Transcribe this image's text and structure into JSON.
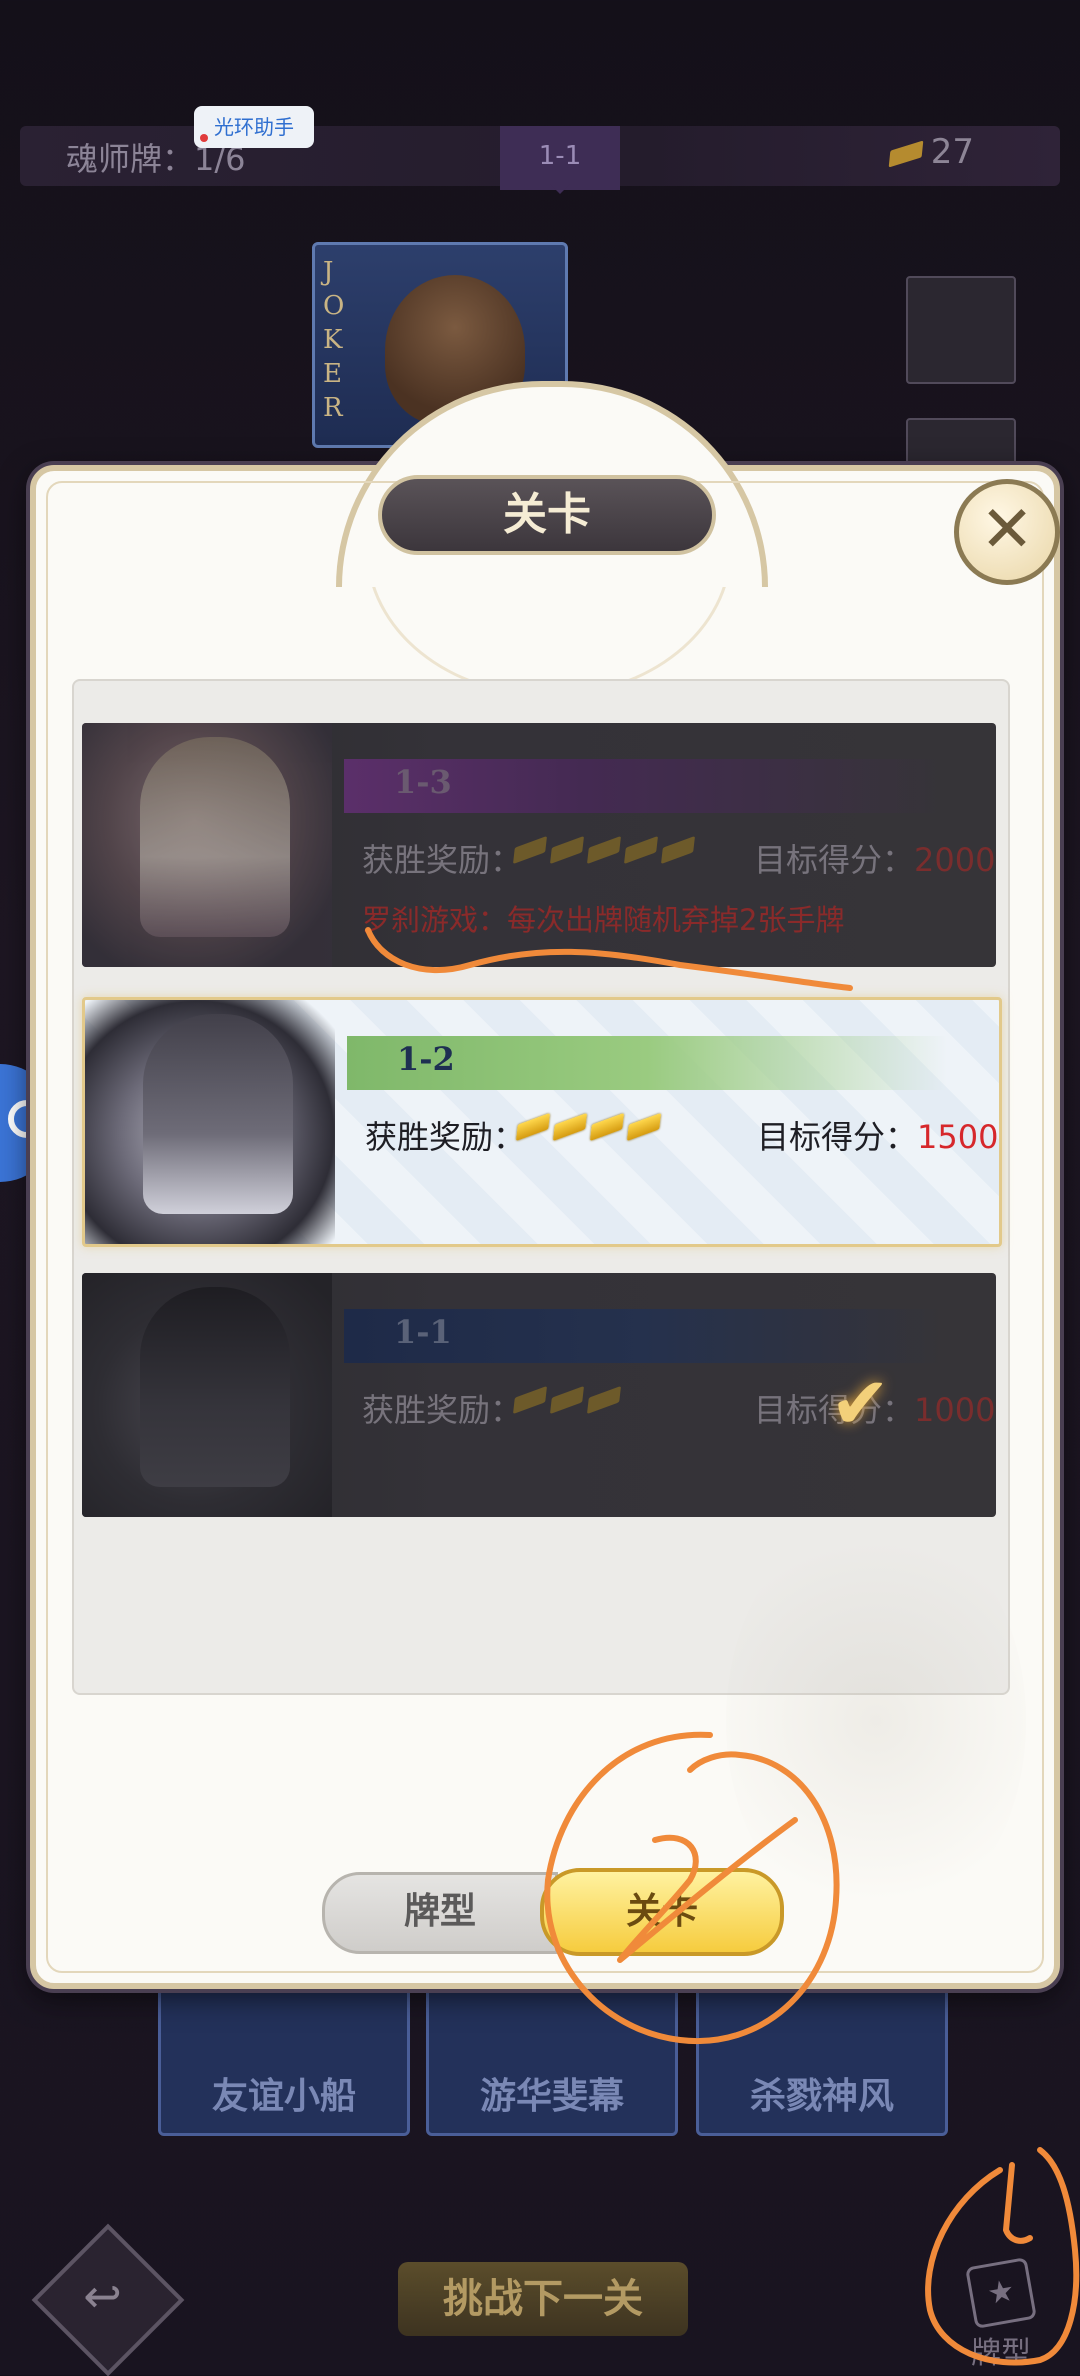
{
  "topbar": {
    "hunter_label": "魂师牌：1/6",
    "current_level": "1-1",
    "gold": "27"
  },
  "assist_badge": "光环助手",
  "joker_letters": "JOKER",
  "bottom_cards": [
    "友谊小船",
    "游华斐幕",
    "杀戮神风"
  ],
  "back_icon": "↩",
  "next_button": "挑战下一关",
  "deck_corner_label": "牌型",
  "modal": {
    "title": "关卡",
    "close": "✕",
    "levels": [
      {
        "id": "1-3",
        "reward_label": "获胜奖励：",
        "reward_gold_bars": 5,
        "target_label": "目标得分：",
        "target_value": "2000",
        "rule": "罗刹游戏：每次出牌随机弃掉2张手牌",
        "state": "locked"
      },
      {
        "id": "1-2",
        "reward_label": "获胜奖励：",
        "reward_gold_bars": 4,
        "target_label": "目标得分：",
        "target_value": "1500",
        "state": "current"
      },
      {
        "id": "1-1",
        "reward_label": "获胜奖励：",
        "reward_gold_bars": 3,
        "target_label": "目标得分：",
        "target_value": "1000",
        "state": "completed",
        "check": "✔"
      }
    ],
    "tabs": {
      "deck": "牌型",
      "levels": "关卡"
    }
  },
  "colors": {
    "accent_gold": "#f6cc3e",
    "target_red": "#d6272b",
    "annotation_orange": "#f08a3a"
  },
  "icons": [
    "gold-bar-icon",
    "close-icon",
    "check-icon",
    "back-icon",
    "deck-icon",
    "joker-portrait"
  ]
}
